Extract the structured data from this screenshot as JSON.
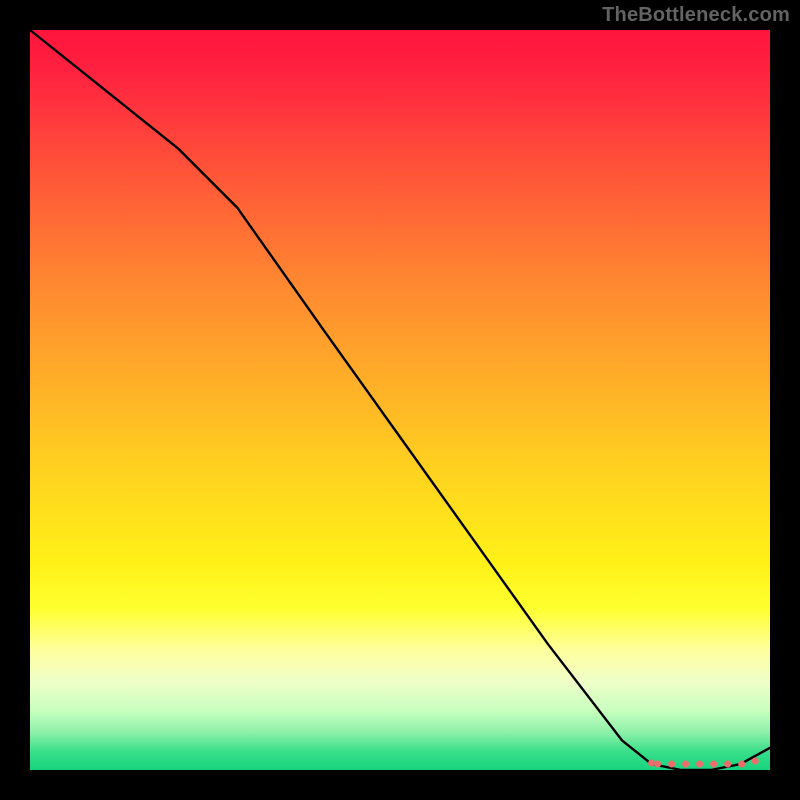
{
  "attribution": "TheBottleneck.com",
  "colors": {
    "dot_stroke": "#ed6d6a",
    "curve_stroke": "#000000"
  },
  "chart_data": {
    "type": "line",
    "title": "",
    "xlabel": "",
    "ylabel": "",
    "xlim": [
      0,
      100
    ],
    "ylim": [
      0,
      100
    ],
    "series": [
      {
        "name": "curve",
        "x": [
          0,
          10,
          20,
          28,
          40,
          50,
          60,
          70,
          80,
          84,
          88,
          92,
          96,
          100
        ],
        "y": [
          100,
          92,
          84,
          76,
          59,
          45,
          31,
          17,
          4,
          0.8,
          0,
          0,
          0.8,
          3
        ]
      }
    ],
    "marker_region": {
      "x_start": 84,
      "x_end": 98,
      "y": 0.4
    }
  }
}
